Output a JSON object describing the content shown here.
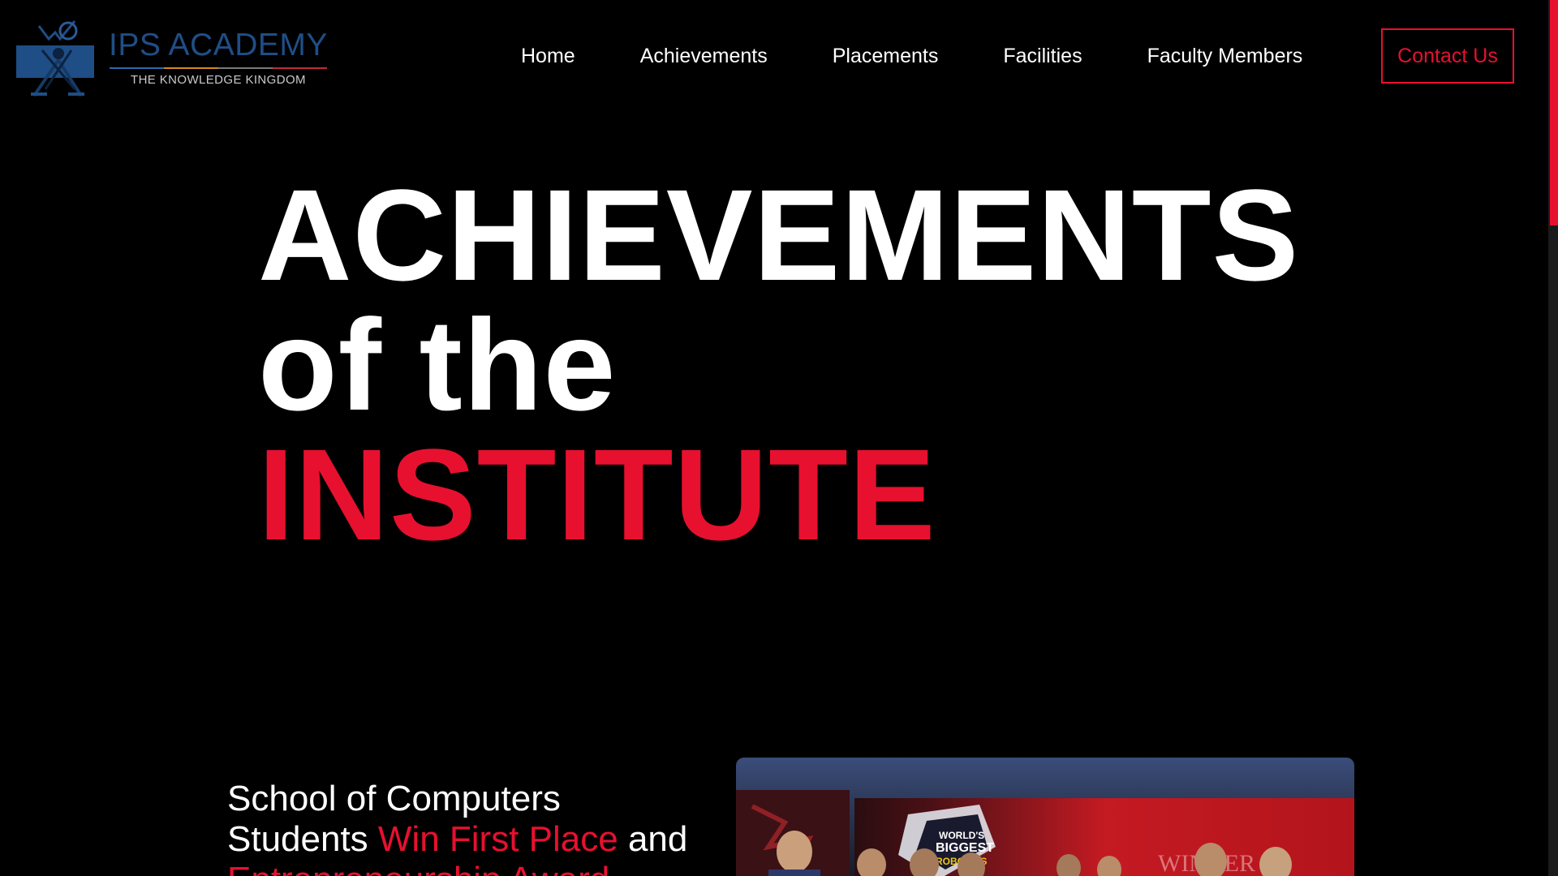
{
  "header": {
    "logo": {
      "name": "IPS ACADEMY",
      "tagline": "THE KNOWLEDGE KINGDOM",
      "icon": "scholar-emblem-icon"
    },
    "nav": [
      {
        "label": "Home"
      },
      {
        "label": "Achievements"
      },
      {
        "label": "Placements"
      },
      {
        "label": "Facilities"
      },
      {
        "label": "Faculty Members"
      }
    ],
    "contact_label": "Contact Us"
  },
  "hero": {
    "line1": "ACHIEVEMENTS",
    "line2": "of the",
    "line3": "INSTITUTE"
  },
  "article": {
    "line1": "School of Computers",
    "line2_a": "Students ",
    "line2_b": "Win First Place",
    "line2_c": " and",
    "line3_partial": "Entrepreneurship Award"
  },
  "photo": {
    "banner_text_1": "WORLD'S",
    "banner_text_2": "BIGGEST",
    "banner_text_3": "ROBOTICS",
    "backdrop_text": "WINNER"
  },
  "colors": {
    "background": "#000000",
    "accent": "#e8102f",
    "text": "#ffffff",
    "logo_blue": "#1f4e86"
  }
}
